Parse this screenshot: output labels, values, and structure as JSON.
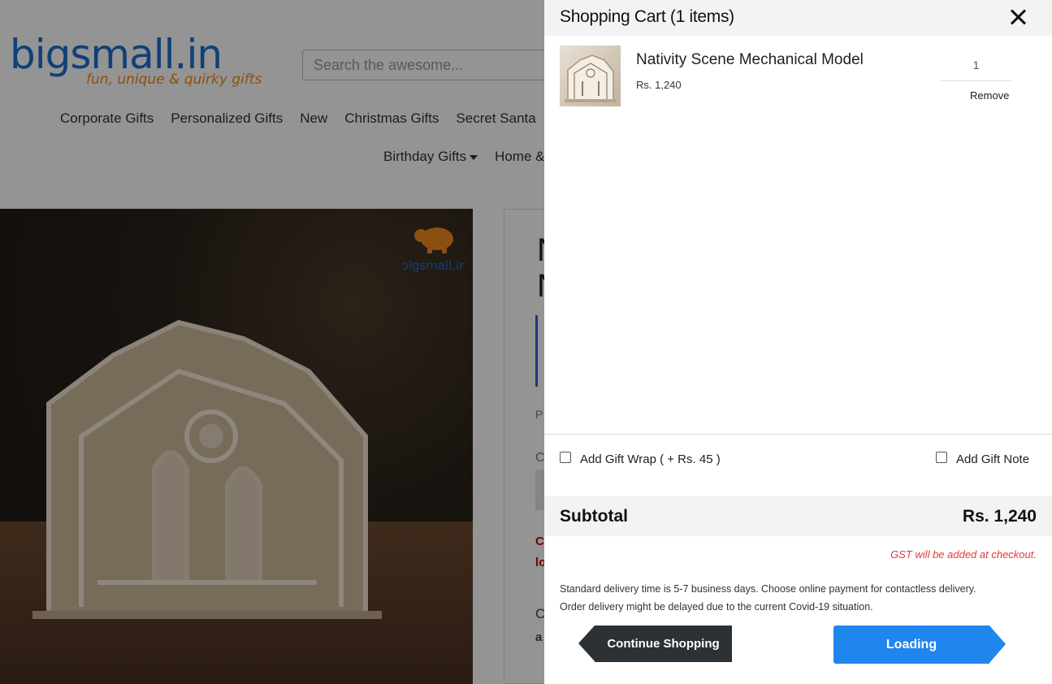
{
  "store": {
    "logo_main": "bigsmall.in",
    "logo_tagline": "fun, unique & quirky gifts",
    "search_placeholder": "Search the awesome...",
    "nav_row1": [
      "Corporate Gifts",
      "Personalized Gifts",
      "New",
      "Christmas Gifts",
      "Secret Santa"
    ],
    "nav_row2": [
      "Birthday Gifts",
      "Home &"
    ],
    "image_watermark": "bigsmall.in",
    "partial_title_1": "N",
    "partial_title_2": "N",
    "partial_text_p": "P",
    "partial_text_c": "C",
    "partial_red_1": "C",
    "partial_red_2": "lo",
    "partial_text_d1": "C",
    "partial_text_d2": "a"
  },
  "cart": {
    "title": "Shopping Cart (1 items)",
    "items": [
      {
        "name": "Nativity Scene Mechanical Model",
        "price": "Rs. 1,240",
        "quantity": "1",
        "remove_label": "Remove"
      }
    ],
    "gift_wrap_label": "Add Gift Wrap ( + Rs. 45 )",
    "gift_note_label": "Add Gift Note",
    "subtotal_label": "Subtotal",
    "subtotal_value": "Rs. 1,240",
    "gst_note": "GST will be added at checkout.",
    "delivery_line1": "Standard delivery time is 5-7 business days. Choose online payment for contactless delivery.",
    "delivery_line2": "Order delivery might be delayed due to the current Covid-19 situation.",
    "continue_label": "Continue Shopping",
    "checkout_label": "Loading"
  },
  "colors": {
    "brand_blue": "#1a6fcf",
    "brand_orange": "#f08a1c",
    "checkout_blue": "#1f86ee",
    "continue_dark": "#2b3135",
    "gst_red": "#e03b3b"
  }
}
